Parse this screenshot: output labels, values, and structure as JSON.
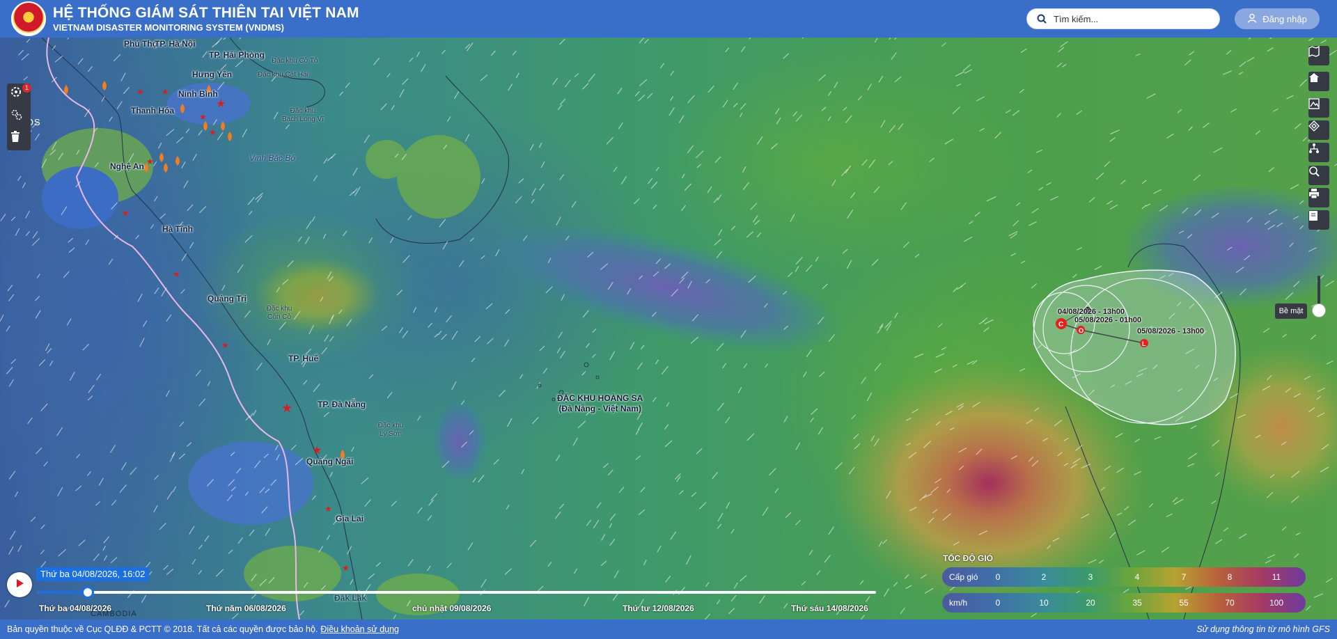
{
  "header": {
    "title_vi": "HỆ THỐNG GIÁM SÁT THIÊN TAI VIỆT NAM",
    "title_en": "VIETNAM DISASTER MONITORING SYSTEM (VNDMS)",
    "search_placeholder": "Tìm kiếm...",
    "login_label": "Đăng nhập"
  },
  "left_tools": {
    "alert_count": "1"
  },
  "map": {
    "provinces": [
      "Phú Thọ",
      "TP. Hà Nội",
      "TP. Hải Phòng",
      "Hưng Yên",
      "Ninh Bình",
      "Thanh Hóa",
      "Nghệ An",
      "Hà Tĩnh",
      "Quảng Trị",
      "TP. Huế",
      "TP. Đà Nẵng",
      "Quảng Ngãi",
      "Gia Lai",
      "Đắk Lắk"
    ],
    "special_zones": [
      "Đặc khu Cô Tô",
      "Đặc khu Cát Hải",
      "Đặc khu Bạch Long Vĩ",
      "Đặc khu Cồn Cỏ",
      "Đặc khu Lý Sơn"
    ],
    "sea": "Vịnh Bắc Bộ",
    "countries": [
      "LAOS",
      "CAMBODIA"
    ],
    "hoang_sa_line1": "ĐẶC KHU HOÀNG SA",
    "hoang_sa_line2": "(Đà Nẵng - Việt Nam)",
    "storm_track": [
      {
        "marker": "C",
        "time": ""
      },
      {
        "marker": "L",
        "time": "04/08/2026 - 13h00"
      },
      {
        "marker": "O",
        "time": "05/08/2026 - 01h00"
      },
      {
        "marker": "L",
        "time": "05/08/2026 - 13h00"
      }
    ]
  },
  "right_tools": {
    "surface_label": "Bề mặt"
  },
  "timeline": {
    "current": "Thứ ba 04/08/2026, 16:02",
    "progress_fraction": 0.06,
    "ticks": [
      "Thứ ba 04/08/2026",
      "Thứ năm 06/08/2026",
      "chủ nhật 09/08/2026",
      "Thứ tư 12/08/2026",
      "Thứ sáu 14/08/2026"
    ]
  },
  "legend": {
    "title": "TỐC ĐỘ GIÓ",
    "row1_name": "Cấp gió",
    "row1_values": [
      "0",
      "2",
      "3",
      "4",
      "7",
      "8",
      "11"
    ],
    "row2_name": "km/h",
    "row2_values": [
      "0",
      "10",
      "20",
      "35",
      "55",
      "70",
      "100"
    ]
  },
  "footer": {
    "copyright": "Bản quyền thuộc về Cục QLĐĐ & PCTT © 2018. Tất cả các quyền được bảo hộ.",
    "terms_link": "Điều khoản sử dụng",
    "source": "Sử dụng thông tin từ mô hình GFS"
  },
  "colors": {
    "header": "#3a6fc9",
    "accent": "#1c6fe0",
    "toolbar": "#353a45"
  }
}
